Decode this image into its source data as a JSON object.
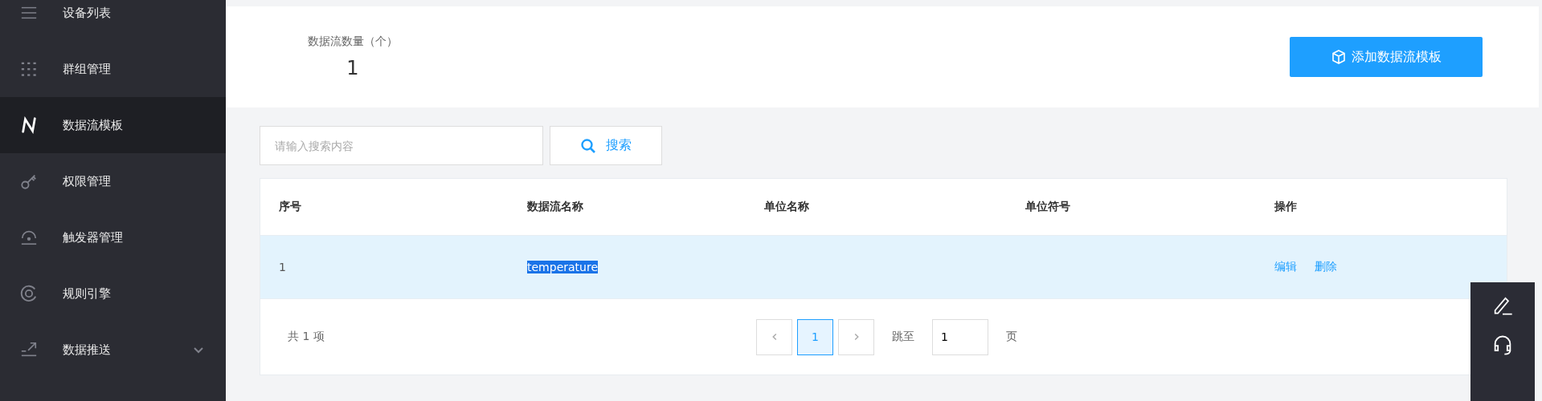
{
  "sidebar": {
    "items": [
      {
        "label": "设备列表",
        "selected": false
      },
      {
        "label": "群组管理",
        "selected": false
      },
      {
        "label": "数据流模板",
        "selected": true
      },
      {
        "label": "权限管理",
        "selected": false
      },
      {
        "label": "触发器管理",
        "selected": false
      },
      {
        "label": "规则引擎",
        "selected": false
      },
      {
        "label": "数据推送",
        "selected": false,
        "expanded": false
      }
    ]
  },
  "summary": {
    "label": "数据流数量（个）",
    "value": "1",
    "add_button": "添加数据流模板"
  },
  "search": {
    "placeholder": "请输入搜索内容",
    "button": "搜索"
  },
  "table": {
    "columns": [
      "序号",
      "数据流名称",
      "单位名称",
      "单位符号",
      "操作"
    ],
    "rows": [
      {
        "selected": true,
        "cells": [
          "1",
          "temperature",
          "",
          ""
        ],
        "name_highlighted": true,
        "actions": [
          "编辑",
          "删除"
        ]
      }
    ]
  },
  "pagination": {
    "total": "共 1 项",
    "pages": [
      {
        "label": "1",
        "selected": true
      }
    ],
    "jump_label": "跳至",
    "jump_value": "1",
    "page_suffix": "页"
  }
}
